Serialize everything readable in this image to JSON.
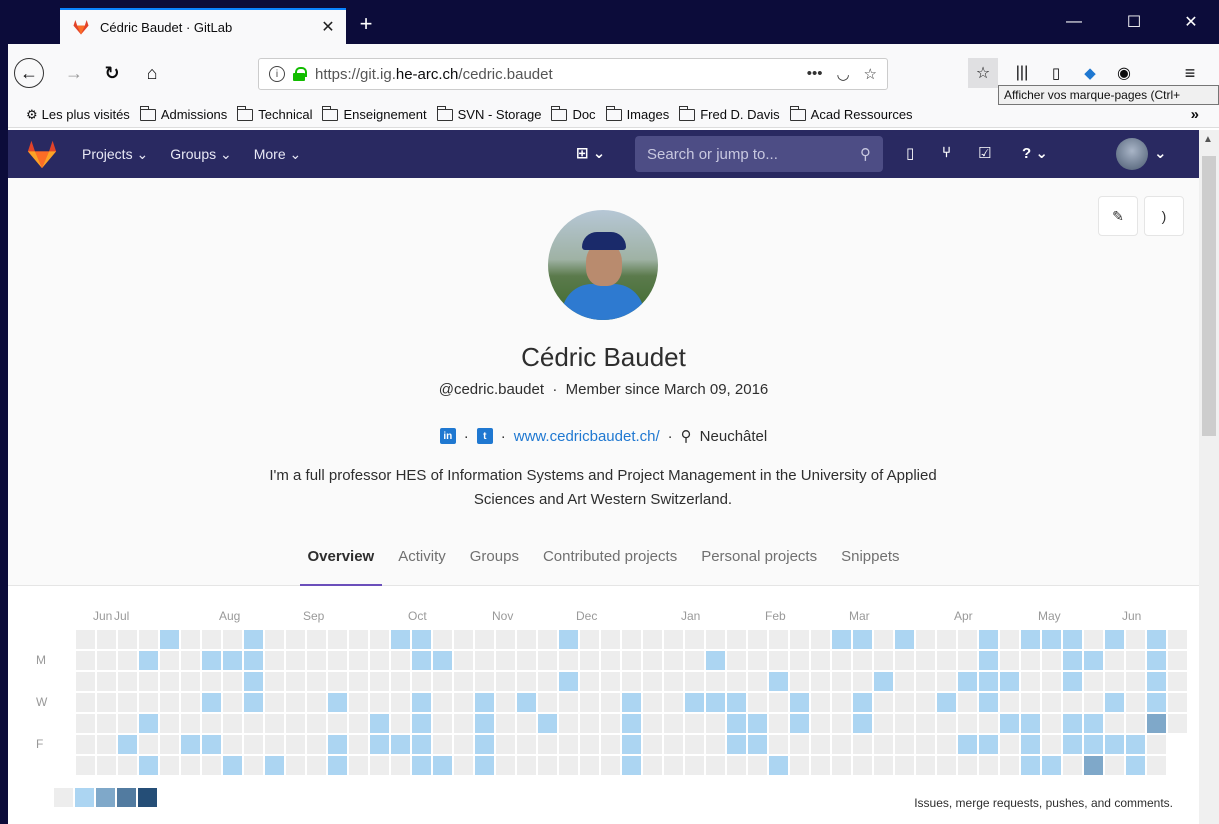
{
  "browser": {
    "tab_title": "Cédric Baudet · GitLab",
    "url_host_prefix": "https://git.ig.",
    "url_host_domain": "he-arc.ch",
    "url_path": "/cedric.baudet",
    "url_actions": "•••",
    "tooltip": "Afficher vos marque-pages (Ctrl+",
    "bookmarks": [
      "Les plus visités",
      "Admissions",
      "Technical",
      "Enseignement",
      "SVN - Storage",
      "Doc",
      "Images",
      "Fred D. Davis",
      "Acad Ressources"
    ]
  },
  "gitlab": {
    "nav": [
      "Projects ⌄",
      "Groups ⌄",
      "More ⌄"
    ],
    "search_placeholder": "Search or jump to..."
  },
  "profile": {
    "name": "Cédric Baudet",
    "meta": "@cedric.baudet  ·  Member since March 09, 2016",
    "website": "www.cedricbaudet.ch/",
    "location": "Neuchâtel",
    "bio": "I'm a full professor HES of Information Systems and Project Management in the University of Applied Sciences and Art Western Switzerland.",
    "tabs": [
      "Overview",
      "Activity",
      "Groups",
      "Contributed projects",
      "Personal projects",
      "Snippets"
    ]
  },
  "calendar": {
    "months": [
      {
        "label": "Jun",
        "col": 1
      },
      {
        "label": "Jul",
        "col": 2
      },
      {
        "label": "Aug",
        "col": 7
      },
      {
        "label": "Sep",
        "col": 11
      },
      {
        "label": "Oct",
        "col": 16
      },
      {
        "label": "Nov",
        "col": 20
      },
      {
        "label": "Dec",
        "col": 24
      },
      {
        "label": "Jan",
        "col": 29
      },
      {
        "label": "Feb",
        "col": 33
      },
      {
        "label": "Mar",
        "col": 37
      },
      {
        "label": "Apr",
        "col": 42
      },
      {
        "label": "May",
        "col": 46
      },
      {
        "label": "Jun",
        "col": 50
      }
    ],
    "day_labels": [
      {
        "label": "M",
        "row": 1
      },
      {
        "label": "W",
        "row": 3
      },
      {
        "label": "F",
        "row": 5
      }
    ],
    "colors": [
      "#ededed",
      "#acd5f2",
      "#7fa8c9",
      "#527ba0",
      "#254e77"
    ],
    "active": [
      [
        4,
        0,
        1
      ],
      [
        8,
        0,
        1
      ],
      [
        15,
        0,
        1
      ],
      [
        16,
        0,
        1
      ],
      [
        23,
        0,
        1
      ],
      [
        36,
        0,
        1
      ],
      [
        37,
        0,
        1
      ],
      [
        39,
        0,
        1
      ],
      [
        43,
        0,
        1
      ],
      [
        45,
        0,
        1
      ],
      [
        46,
        0,
        1
      ],
      [
        47,
        0,
        1
      ],
      [
        49,
        0,
        1
      ],
      [
        51,
        0,
        1
      ],
      [
        3,
        1,
        1
      ],
      [
        6,
        1,
        1
      ],
      [
        7,
        1,
        1
      ],
      [
        8,
        1,
        1
      ],
      [
        16,
        1,
        1
      ],
      [
        17,
        1,
        1
      ],
      [
        30,
        1,
        1
      ],
      [
        43,
        1,
        1
      ],
      [
        47,
        1,
        1
      ],
      [
        48,
        1,
        1
      ],
      [
        51,
        1,
        1
      ],
      [
        8,
        2,
        1
      ],
      [
        23,
        2,
        1
      ],
      [
        33,
        2,
        1
      ],
      [
        38,
        2,
        1
      ],
      [
        42,
        2,
        1
      ],
      [
        43,
        2,
        1
      ],
      [
        44,
        2,
        1
      ],
      [
        47,
        2,
        1
      ],
      [
        51,
        2,
        1
      ],
      [
        6,
        3,
        1
      ],
      [
        8,
        3,
        1
      ],
      [
        12,
        3,
        1
      ],
      [
        16,
        3,
        1
      ],
      [
        19,
        3,
        1
      ],
      [
        21,
        3,
        1
      ],
      [
        26,
        3,
        1
      ],
      [
        29,
        3,
        1
      ],
      [
        30,
        3,
        1
      ],
      [
        31,
        3,
        1
      ],
      [
        34,
        3,
        1
      ],
      [
        37,
        3,
        1
      ],
      [
        41,
        3,
        1
      ],
      [
        43,
        3,
        1
      ],
      [
        49,
        3,
        1
      ],
      [
        51,
        3,
        1
      ],
      [
        3,
        4,
        1
      ],
      [
        14,
        4,
        1
      ],
      [
        16,
        4,
        1
      ],
      [
        19,
        4,
        1
      ],
      [
        22,
        4,
        1
      ],
      [
        26,
        4,
        1
      ],
      [
        31,
        4,
        1
      ],
      [
        32,
        4,
        1
      ],
      [
        34,
        4,
        1
      ],
      [
        37,
        4,
        1
      ],
      [
        44,
        4,
        1
      ],
      [
        45,
        4,
        1
      ],
      [
        47,
        4,
        1
      ],
      [
        48,
        4,
        1
      ],
      [
        51,
        4,
        2
      ],
      [
        2,
        5,
        1
      ],
      [
        5,
        5,
        1
      ],
      [
        6,
        5,
        1
      ],
      [
        12,
        5,
        1
      ],
      [
        14,
        5,
        1
      ],
      [
        15,
        5,
        1
      ],
      [
        16,
        5,
        1
      ],
      [
        19,
        5,
        1
      ],
      [
        26,
        5,
        1
      ],
      [
        31,
        5,
        1
      ],
      [
        32,
        5,
        1
      ],
      [
        42,
        5,
        1
      ],
      [
        43,
        5,
        1
      ],
      [
        45,
        5,
        1
      ],
      [
        47,
        5,
        1
      ],
      [
        48,
        5,
        1
      ],
      [
        49,
        5,
        1
      ],
      [
        50,
        5,
        1
      ],
      [
        3,
        6,
        1
      ],
      [
        7,
        6,
        1
      ],
      [
        9,
        6,
        1
      ],
      [
        12,
        6,
        1
      ],
      [
        16,
        6,
        1
      ],
      [
        17,
        6,
        1
      ],
      [
        19,
        6,
        1
      ],
      [
        26,
        6,
        1
      ],
      [
        33,
        6,
        1
      ],
      [
        45,
        6,
        1
      ],
      [
        46,
        6,
        1
      ],
      [
        48,
        6,
        2
      ],
      [
        50,
        6,
        1
      ]
    ],
    "legend_text": "Issues, merge requests, pushes, and comments."
  }
}
